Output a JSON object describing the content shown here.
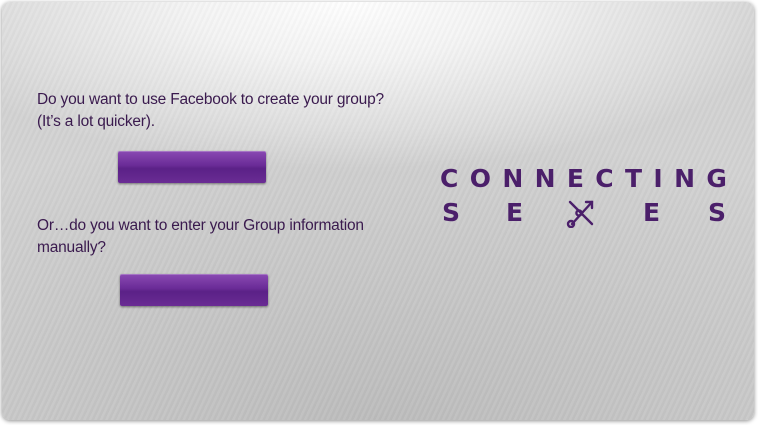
{
  "prompt1": {
    "line1": "Do you want to use Facebook to create your group?",
    "line2": "(It’s a lot quicker)."
  },
  "prompt2": {
    "line1": "Or…do you want to enter your Group information",
    "line2": "manually?"
  },
  "buttons": {
    "facebook_label": "",
    "manual_label": ""
  },
  "logo": {
    "row1": [
      "C",
      "O",
      "N",
      "N",
      "E",
      "C",
      "T",
      "I",
      "N",
      "G"
    ],
    "row2": [
      "S",
      "E",
      "E",
      "S"
    ],
    "mark_icon": "crossed-arrows-icon"
  },
  "colors": {
    "text": "#3a1a4e",
    "button": "#6a2b97",
    "logo": "#4b1f6a"
  }
}
